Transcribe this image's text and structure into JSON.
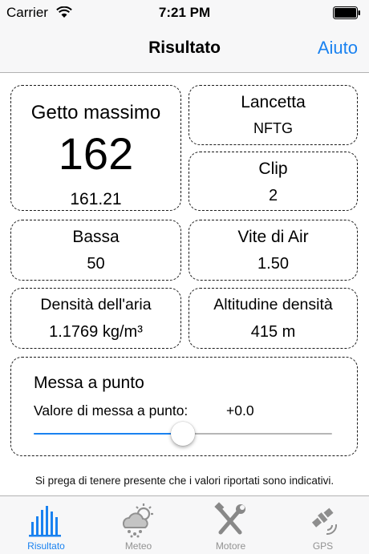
{
  "status_bar": {
    "carrier": "Carrier",
    "time": "7:21 PM"
  },
  "nav": {
    "title": "Risultato",
    "help": "Aiuto"
  },
  "cards": {
    "jet": {
      "title": "Getto massimo",
      "value": "162",
      "sub": "161.21"
    },
    "needle": {
      "title": "Lancetta",
      "value": "NFTG"
    },
    "clip": {
      "title": "Clip",
      "value": "2"
    },
    "low": {
      "title": "Bassa",
      "value": "50"
    },
    "air_screw": {
      "title": "Vite di Air",
      "value": "1.50"
    },
    "air_density": {
      "title": "Densità dell'aria",
      "value": "1.1769 kg/m³"
    },
    "density_altitude": {
      "title": "Altitudine densità",
      "value": "415 m"
    }
  },
  "tuning": {
    "title": "Messa a punto",
    "label": "Valore di messa a punto:",
    "value": "+0.0",
    "slider_level": 0.5
  },
  "disclaimer": "Si prega di tenere presente che i valori riportati sono indicativi.",
  "tabs": [
    {
      "label": "Risultato",
      "icon": "bar-chart-icon",
      "active": true
    },
    {
      "label": "Meteo",
      "icon": "weather-icon",
      "active": false
    },
    {
      "label": "Motore",
      "icon": "tools-icon",
      "active": false
    },
    {
      "label": "GPS",
      "icon": "satellite-icon",
      "active": false
    }
  ],
  "colors": {
    "accent": "#1a82f0",
    "inactive": "#929292"
  }
}
